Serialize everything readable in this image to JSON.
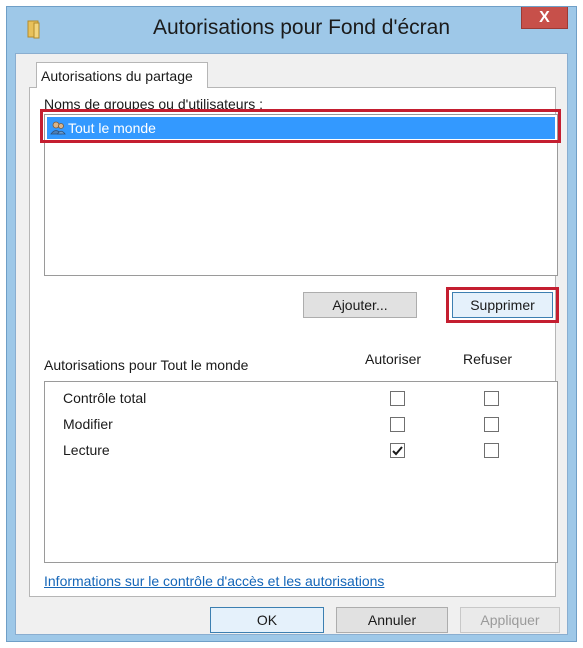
{
  "window": {
    "title": "Autorisations pour Fond d'écran",
    "close_label": "X"
  },
  "tab": {
    "label": "Autorisations du partage"
  },
  "users": {
    "label": "Noms de groupes ou d'utilisateurs :",
    "items": [
      {
        "name": "Tout le monde",
        "selected": true
      }
    ]
  },
  "buttons": {
    "add_label": "Ajouter...",
    "remove_label": "Supprimer",
    "ok_label": "OK",
    "cancel_label": "Annuler",
    "apply_label": "Appliquer"
  },
  "permissions": {
    "title": "Autorisations pour Tout le monde",
    "allow_header": "Autoriser",
    "deny_header": "Refuser",
    "rows": [
      {
        "name": "Contrôle total",
        "allow": false,
        "deny": false
      },
      {
        "name": "Modifier",
        "allow": false,
        "deny": false
      },
      {
        "name": "Lecture",
        "allow": true,
        "deny": false
      }
    ]
  },
  "link": {
    "text": "Informations sur le contrôle d'accès et les autorisations"
  },
  "colors": {
    "selection": "#3399ff",
    "highlight_frame": "#c41e30",
    "close_button": "#c7504a",
    "link": "#1566b8"
  },
  "icons": {
    "title": "folder-icon",
    "user": "users-group-icon",
    "check": "checkmark-icon"
  }
}
